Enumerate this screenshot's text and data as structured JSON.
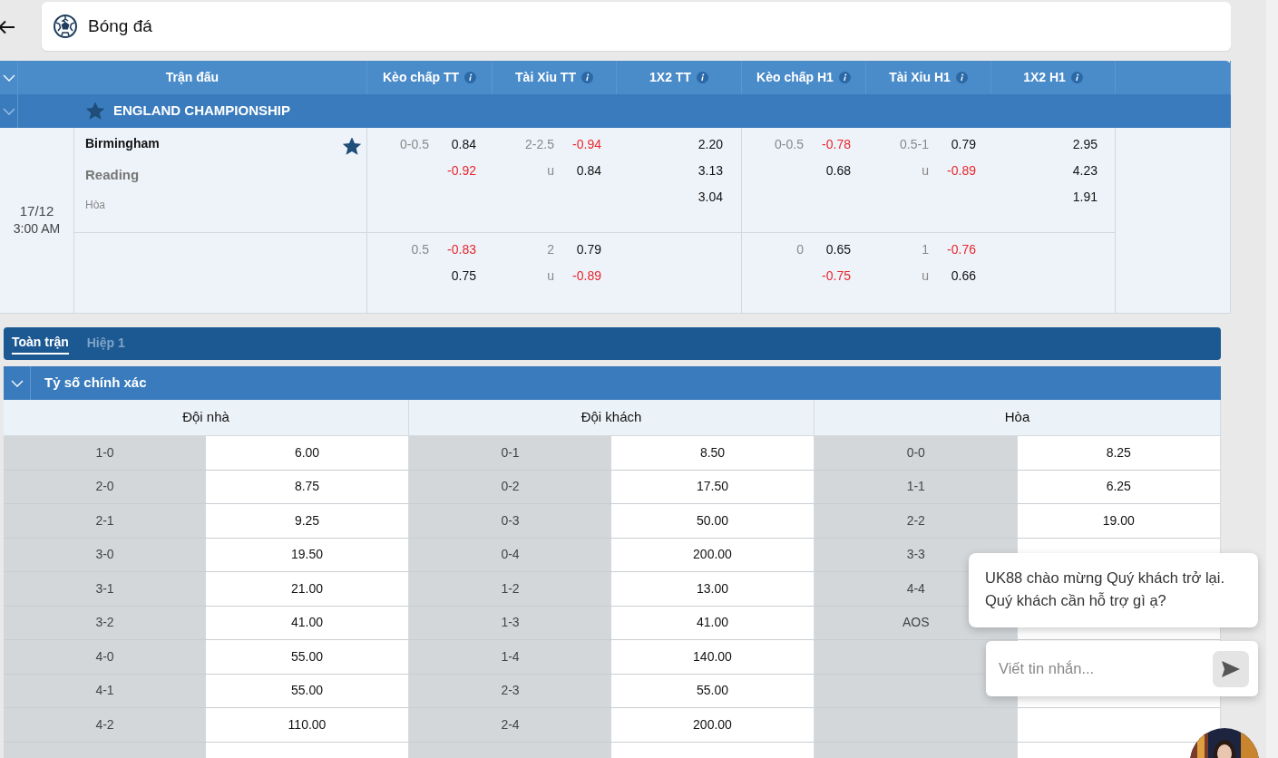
{
  "header": {
    "title": "Bóng đá"
  },
  "columns": [
    {
      "label": "Trận đấu",
      "info": false
    },
    {
      "label": "Kèo chấp TT",
      "info": true
    },
    {
      "label": "Tài Xỉu TT",
      "info": true
    },
    {
      "label": "1X2 TT",
      "info": true
    },
    {
      "label": "Kèo chấp H1",
      "info": true
    },
    {
      "label": "Tài Xỉu H1",
      "info": true
    },
    {
      "label": "1X2 H1",
      "info": true
    }
  ],
  "league": {
    "name": "ENGLAND CHAMPIONSHIP",
    "favorite": true
  },
  "match": {
    "date": "17/12",
    "time": "3:00 AM",
    "home": "Birmingham",
    "away": "Reading",
    "draw_label": "Hòa",
    "favorite": true,
    "lines": [
      {
        "periods": [
          {
            "handicap": {
              "line": "0-0.5",
              "home": {
                "value": "0.84",
                "negative": false
              },
              "away": {
                "value": "-0.92",
                "negative": true
              }
            },
            "over_under": {
              "line": "2-2.5",
              "over": {
                "value": "-0.94",
                "negative": true
              },
              "under_label": "u",
              "under": {
                "value": "0.84",
                "negative": false
              }
            },
            "one_x_two": [
              "2.20",
              "3.13",
              "3.04"
            ]
          },
          {
            "handicap": {
              "line": "0-0.5",
              "home": {
                "value": "-0.78",
                "negative": true
              },
              "away": {
                "value": "0.68",
                "negative": false
              }
            },
            "over_under": {
              "line": "0.5-1",
              "over": {
                "value": "0.79",
                "negative": false
              },
              "under_label": "u",
              "under": {
                "value": "-0.89",
                "negative": true
              }
            },
            "one_x_two": [
              "2.95",
              "4.23",
              "1.91"
            ]
          }
        ]
      },
      {
        "periods": [
          {
            "handicap": {
              "line": "0.5",
              "home": {
                "value": "-0.83",
                "negative": true
              },
              "away": {
                "value": "0.75",
                "negative": false
              }
            },
            "over_under": {
              "line": "2",
              "over": {
                "value": "0.79",
                "negative": false
              },
              "under_label": "u",
              "under": {
                "value": "-0.89",
                "negative": true
              }
            }
          },
          {
            "handicap": {
              "line": "0",
              "home": {
                "value": "0.65",
                "negative": false
              },
              "away": {
                "value": "-0.75",
                "negative": true
              }
            },
            "over_under": {
              "line": "1",
              "over": {
                "value": "-0.76",
                "negative": true
              },
              "under_label": "u",
              "under": {
                "value": "0.66",
                "negative": false
              }
            }
          }
        ]
      }
    ]
  },
  "tabs": [
    {
      "label": "Toàn trận",
      "selected": true
    },
    {
      "label": "Hiệp 1",
      "selected": false
    }
  ],
  "market": {
    "title": "Tỷ số chính xác",
    "groups": [
      {
        "label": "Đội nhà",
        "rows": [
          {
            "score": "1-0",
            "odds": "6.00"
          },
          {
            "score": "2-0",
            "odds": "8.75"
          },
          {
            "score": "2-1",
            "odds": "9.25"
          },
          {
            "score": "3-0",
            "odds": "19.50"
          },
          {
            "score": "3-1",
            "odds": "21.00"
          },
          {
            "score": "3-2",
            "odds": "41.00"
          },
          {
            "score": "4-0",
            "odds": "55.00"
          },
          {
            "score": "4-1",
            "odds": "55.00"
          },
          {
            "score": "4-2",
            "odds": "110.00"
          }
        ]
      },
      {
        "label": "Đội khách",
        "rows": [
          {
            "score": "0-1",
            "odds": "8.50"
          },
          {
            "score": "0-2",
            "odds": "17.50"
          },
          {
            "score": "0-3",
            "odds": "50.00"
          },
          {
            "score": "0-4",
            "odds": "200.00"
          },
          {
            "score": "1-2",
            "odds": "13.00"
          },
          {
            "score": "1-3",
            "odds": "41.00"
          },
          {
            "score": "1-4",
            "odds": "140.00"
          },
          {
            "score": "2-3",
            "odds": "55.00"
          },
          {
            "score": "2-4",
            "odds": "200.00"
          }
        ]
      },
      {
        "label": "Hòa",
        "rows": [
          {
            "score": "0-0",
            "odds": "8.25"
          },
          {
            "score": "1-1",
            "odds": "6.25"
          },
          {
            "score": "2-2",
            "odds": "19.00"
          },
          {
            "score": "3-3"
          },
          {
            "score": "4-4"
          },
          {
            "score": "AOS"
          }
        ]
      }
    ]
  },
  "chat": {
    "message": "UK88 chào mừng Quý khách trở lại. Quý khách cần hỗ trợ gì ạ?",
    "placeholder": "Viết tin nhắn..."
  }
}
